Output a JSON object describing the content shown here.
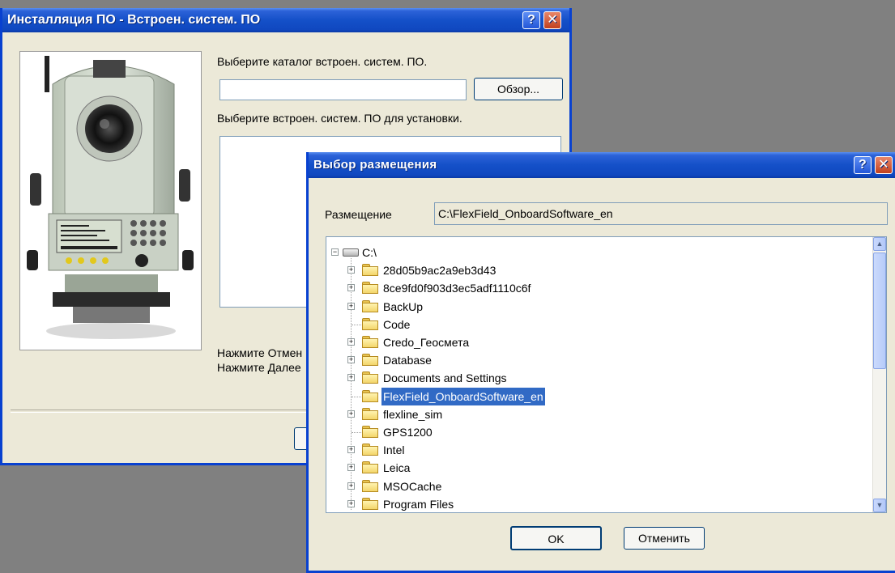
{
  "main_window": {
    "title": "Инсталляция ПО - Встроен. систем. ПО",
    "help_glyph": "?",
    "close_glyph": "✕",
    "select_dir_label": "Выберите каталог встроен. систем. ПО.",
    "dir_input_value": "",
    "browse_label": "Обзор...",
    "select_software_label": "Выберите встроен. систем. ПО для установки.",
    "cancel_hint": "Нажмите Отмен",
    "next_hint": "Нажмите Далее"
  },
  "location_dialog": {
    "title": "Выбор размещения",
    "help_glyph": "?",
    "close_glyph": "✕",
    "location_label": "Размещение",
    "location_value": "C:\\FlexField_OnboardSoftware_en",
    "ok_label": "OK",
    "cancel_label": "Отменить",
    "tree_root": "C:\\",
    "tree_items": [
      {
        "label": "28d05b9ac2a9eb3d43",
        "expandable": true,
        "selected": false
      },
      {
        "label": "8ce9fd0f903d3ec5adf1110c6f",
        "expandable": true,
        "selected": false
      },
      {
        "label": "BackUp",
        "expandable": true,
        "selected": false
      },
      {
        "label": "Code",
        "expandable": false,
        "selected": false
      },
      {
        "label": "Credo_Геосмета",
        "expandable": true,
        "selected": false
      },
      {
        "label": "Database",
        "expandable": true,
        "selected": false
      },
      {
        "label": "Documents and Settings",
        "expandable": true,
        "selected": false
      },
      {
        "label": "FlexField_OnboardSoftware_en",
        "expandable": false,
        "selected": true
      },
      {
        "label": "flexline_sim",
        "expandable": true,
        "selected": false
      },
      {
        "label": "GPS1200",
        "expandable": false,
        "selected": false
      },
      {
        "label": "Intel",
        "expandable": true,
        "selected": false
      },
      {
        "label": "Leica",
        "expandable": true,
        "selected": false
      },
      {
        "label": "MSOCache",
        "expandable": true,
        "selected": false
      },
      {
        "label": "Program Files",
        "expandable": true,
        "selected": false
      }
    ]
  },
  "colors": {
    "titlebar": "#1450c8",
    "window_bg": "#ece9d8",
    "selection": "#316ac5",
    "desktop": "#808080"
  },
  "icons": {
    "drive": "drive-icon",
    "folder": "folder-icon",
    "total_station_photo": "total-station-image"
  }
}
